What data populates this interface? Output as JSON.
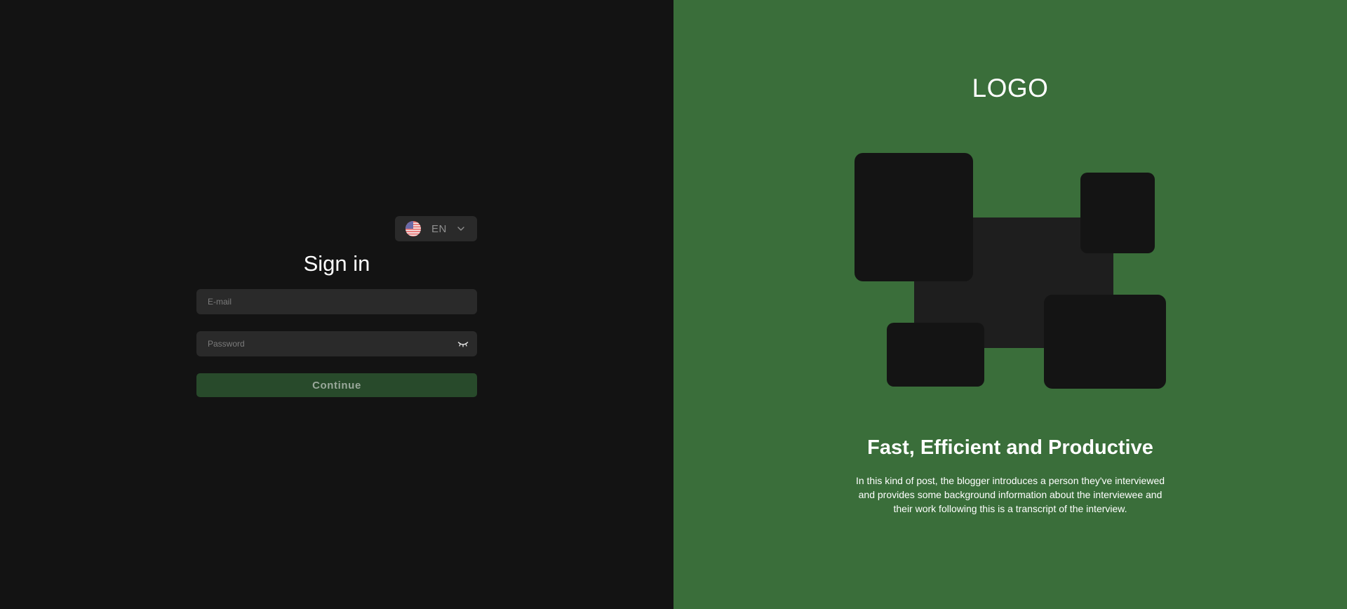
{
  "language": {
    "code": "EN",
    "flag": "us-flag-icon"
  },
  "signin": {
    "title": "Sign in",
    "email_placeholder": "E-mail",
    "password_placeholder": "Password",
    "continue_label": "Continue"
  },
  "promo": {
    "logo": "LOGO",
    "headline": "Fast, Efficient and Productive",
    "description": "In this kind of post, the blogger introduces a person they've interviewed and provides some background information about the interviewee and their work following this is a transcript of the interview."
  },
  "colors": {
    "left_background": "#131313",
    "right_background": "#3a6e3a",
    "input_background": "#2a2a2a",
    "button_background": "#284a2b",
    "tile": "#141414"
  }
}
